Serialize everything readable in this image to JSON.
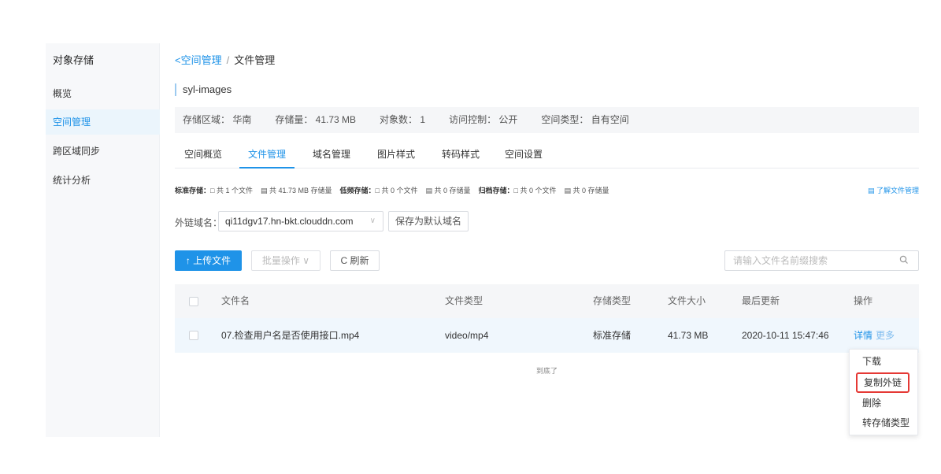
{
  "sidebar": {
    "title": "对象存储",
    "items": [
      {
        "label": "概览"
      },
      {
        "label": "空间管理"
      },
      {
        "label": "跨区域同步"
      },
      {
        "label": "统计分析"
      }
    ]
  },
  "breadcrumb": {
    "back_label": "空间管理",
    "separator": "/",
    "current": "文件管理"
  },
  "bucket": {
    "name": "syl-images"
  },
  "info_bar": {
    "region": "存储区域： 华南",
    "storage": "存储量： 41.73 MB",
    "objects": "对象数： 1",
    "access": "访问控制： 公开",
    "space_type": "空间类型： 自有空间"
  },
  "tabs": [
    {
      "label": "空间概览"
    },
    {
      "label": "文件管理"
    },
    {
      "label": "域名管理"
    },
    {
      "label": "图片样式"
    },
    {
      "label": "转码样式"
    },
    {
      "label": "空间设置"
    }
  ],
  "stats": {
    "standard_label": "标准存储：",
    "standard_files": "共 1 个文件",
    "standard_size": "共 41.73 MB 存储量",
    "low_label": "低频存储：",
    "low_files": "共 0 个文件",
    "low_size": "共 0 存储量",
    "archive_label": "归档存储：",
    "archive_files": "共 0 个文件",
    "archive_size": "共 0 存储量",
    "learn_link": "了解文件管理"
  },
  "domain": {
    "label": "外链域名：",
    "value": "qi11dgv17.hn-bkt.clouddn.com",
    "save_default": "保存为默认域名"
  },
  "toolbar": {
    "upload": "上传文件",
    "batch": "批量操作",
    "refresh": "刷新",
    "search_placeholder": "请输入文件名前缀搜索"
  },
  "table": {
    "headers": {
      "name": "文件名",
      "type": "文件类型",
      "storage_type": "存储类型",
      "size": "文件大小",
      "updated": "最后更新",
      "actions": "操作"
    },
    "rows": [
      {
        "name": "07.检查用户名是否使用接口.mp4",
        "type": "video/mp4",
        "storage_type": "标准存储",
        "size": "41.73 MB",
        "updated": "2020-10-11 15:47:46",
        "detail": "详情",
        "more": "更多"
      }
    ],
    "end_text": "到底了"
  },
  "dropdown": {
    "items": [
      {
        "label": "下载"
      },
      {
        "label": "复制外链"
      },
      {
        "label": "删除"
      },
      {
        "label": "转存储类型"
      }
    ]
  },
  "colors": {
    "accent": "#1f93e8",
    "highlight_border": "#e53935"
  }
}
